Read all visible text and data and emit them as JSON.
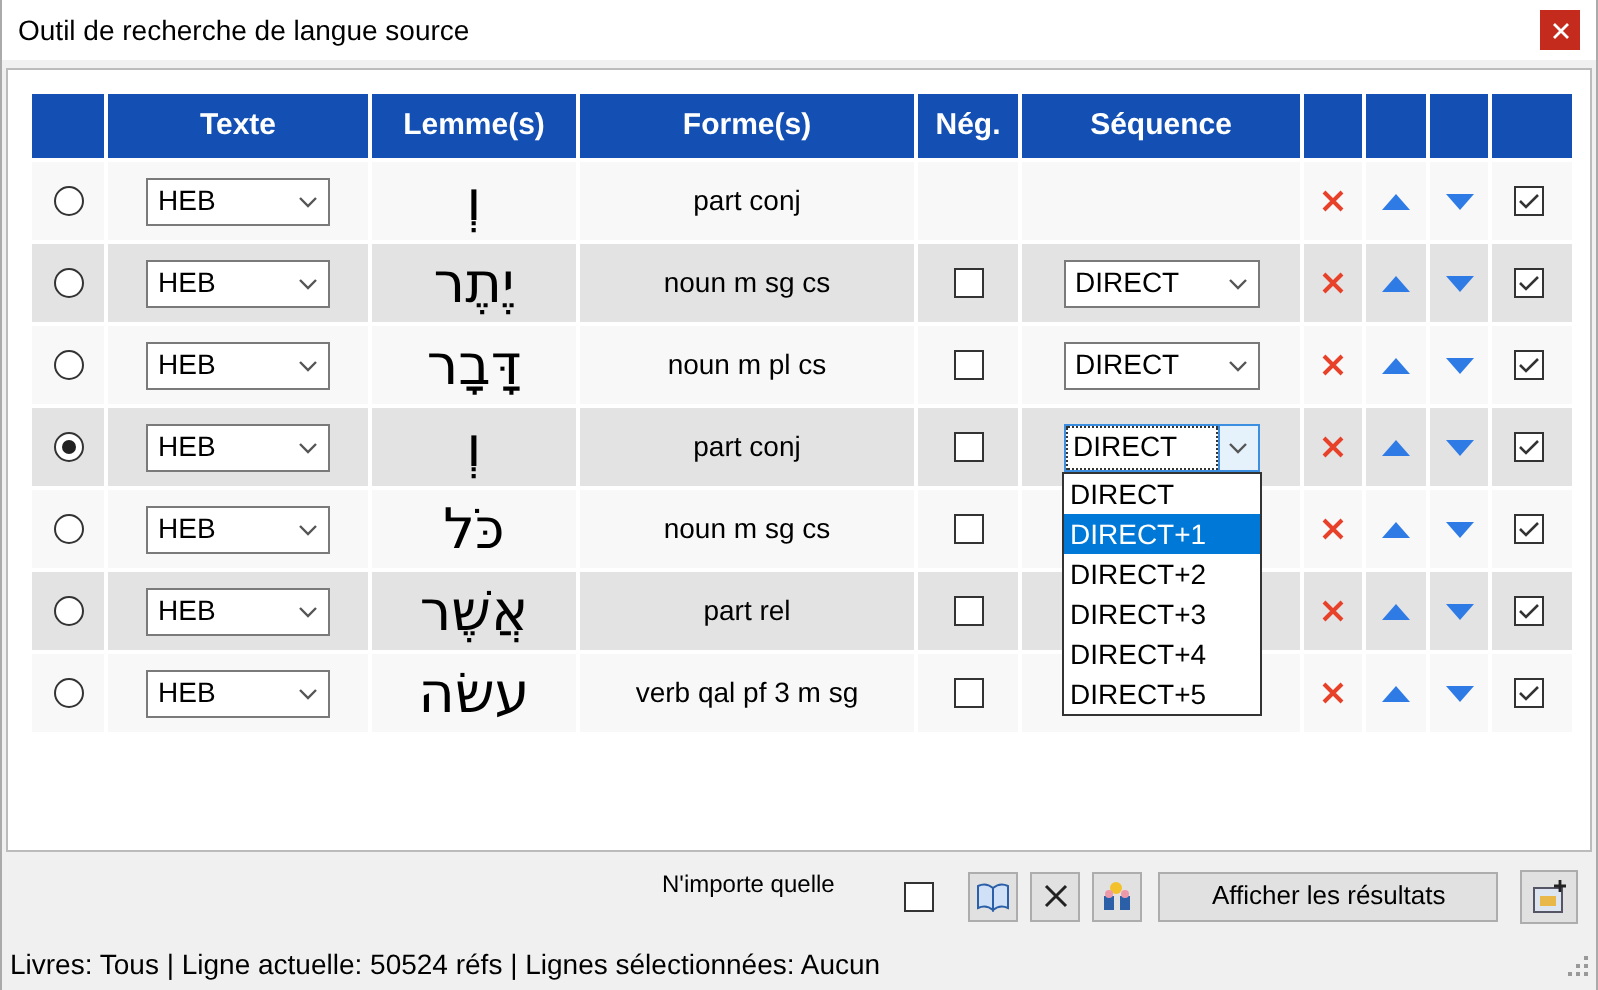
{
  "window": {
    "title": "Outil de recherche de langue source"
  },
  "table": {
    "columns": [
      "Texte",
      "Lemme(s)",
      "Forme(s)",
      "Nég.",
      "Séquence"
    ],
    "rows": [
      {
        "selected": false,
        "text": "HEB",
        "lemma": "וְ",
        "form": "part conj",
        "enabled": true
      },
      {
        "selected": false,
        "text": "HEB",
        "lemma": "יֶתֶר",
        "form": "noun m sg cs",
        "neg": {
          "checked": false
        },
        "sequence": {
          "value": "DIRECT"
        },
        "enabled": true
      },
      {
        "selected": false,
        "text": "HEB",
        "lemma": "דָּבָר",
        "form": "noun m pl cs",
        "neg": {
          "checked": false
        },
        "sequence": {
          "value": "DIRECT"
        },
        "enabled": true
      },
      {
        "selected": true,
        "text": "HEB",
        "lemma": "וְ",
        "form": "part conj",
        "neg": {
          "checked": false
        },
        "sequence": {
          "value": "DIRECT",
          "open": true,
          "options": [
            {
              "label": "DIRECT",
              "highlighted": false
            },
            {
              "label": "DIRECT+1",
              "highlighted": true
            },
            {
              "label": "DIRECT+2",
              "highlighted": false
            },
            {
              "label": "DIRECT+3",
              "highlighted": false
            },
            {
              "label": "DIRECT+4",
              "highlighted": false
            },
            {
              "label": "DIRECT+5",
              "highlighted": false
            }
          ]
        },
        "enabled": true
      },
      {
        "selected": false,
        "text": "HEB",
        "lemma": "כֹּל",
        "form": "noun m sg cs",
        "neg": {
          "checked": false
        },
        "enabled": true
      },
      {
        "selected": false,
        "text": "HEB",
        "lemma": "אֲשֶׁר",
        "form": "part rel",
        "neg": {
          "checked": false
        },
        "enabled": true
      },
      {
        "selected": false,
        "text": "HEB",
        "lemma": "עשׂה",
        "form": "verb qal pf 3 m sg",
        "neg": {
          "checked": false
        },
        "enabled": true
      }
    ]
  },
  "footer": {
    "any_label": "N'importe quelle",
    "any_checked": false,
    "show_button": "Afficher les résultats"
  },
  "status_bar": "Livres: Tous | Ligne actuelle: 50524 réfs | Lignes sélectionnées: Aucun"
}
